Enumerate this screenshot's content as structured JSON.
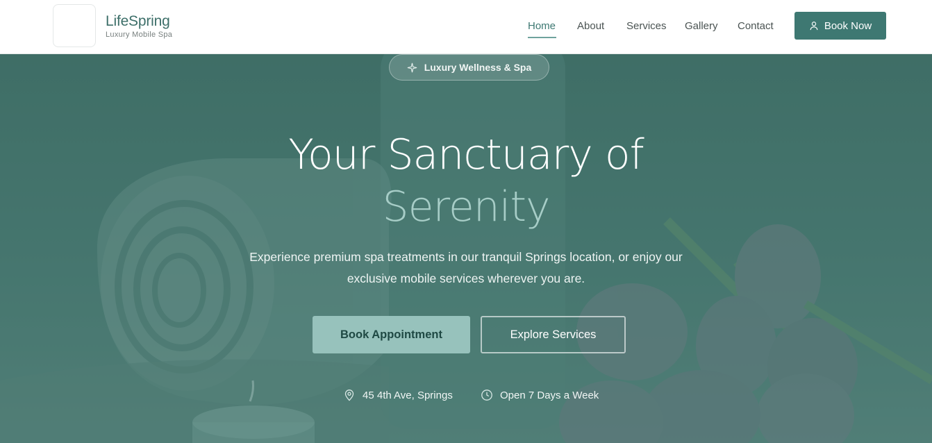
{
  "header": {
    "brand_name": "LifeSpring",
    "brand_tagline": "Luxury Mobile Spa",
    "nav": [
      {
        "label": "Home",
        "active": true
      },
      {
        "label": "About",
        "active": false
      },
      {
        "label": "Services",
        "active": false
      },
      {
        "label": "Gallery",
        "active": false
      },
      {
        "label": "Contact",
        "active": false
      }
    ],
    "book_now_label": "Book Now",
    "book_now_icon": "user-icon"
  },
  "hero": {
    "badge_icon": "sparkle-icon",
    "badge_label": "Luxury Wellness & Spa",
    "title_line1": "Your Sanctuary of",
    "title_line2": "Serenity",
    "description": "Experience premium spa treatments in our tranquil Springs location, or enjoy our exclusive mobile services wherever you are.",
    "primary_button": "Book Appointment",
    "secondary_button": "Explore Services",
    "address_icon": "map-pin-icon",
    "address": "45 4th Ave, Springs",
    "hours_icon": "clock-icon",
    "hours": "Open 7 Days a Week"
  },
  "colors": {
    "accent": "#3e7872",
    "hero_overlay": "#4a7a73",
    "highlight_text": "#a7cdc7",
    "primary_button_bg": "#97c2bc"
  }
}
